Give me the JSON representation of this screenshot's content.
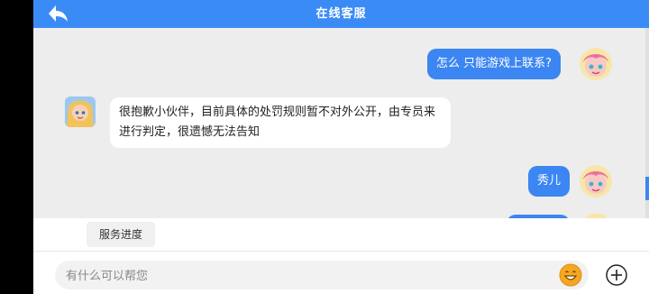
{
  "header": {
    "title": "在线客服",
    "back_icon": "back-arrow-icon"
  },
  "messages": [
    {
      "side": "out",
      "text": "怎么 只能游戏上联系?"
    },
    {
      "side": "in",
      "text": "很抱歉小伙伴，目前具体的处罚规则暂不对外公开，由专员来进行判定，很遗憾无法告知"
    },
    {
      "side": "out",
      "text": "秀儿"
    }
  ],
  "quick_actions": [
    "服务进度"
  ],
  "input": {
    "placeholder": "有什么可以帮您"
  },
  "icons": {
    "emoji": "emoji-icon",
    "plus": "plus-icon"
  },
  "colors": {
    "accent": "#3b8bf6",
    "bubble_out": "#3b86f2",
    "bubble_in": "#ffffff",
    "chat_bg": "#ededed"
  }
}
